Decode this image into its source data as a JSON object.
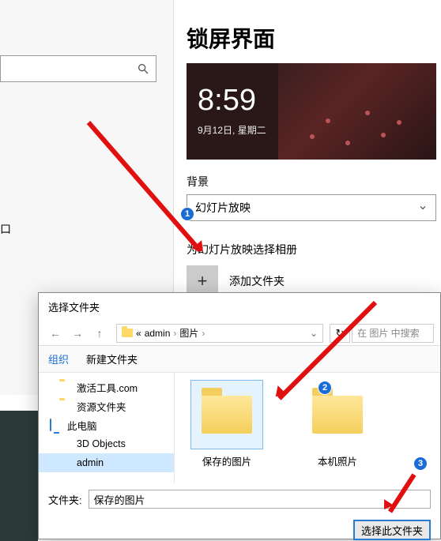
{
  "settings": {
    "title": "锁屏界面",
    "preview": {
      "time": "8:59",
      "date": "9月12日, 星期二"
    },
    "bg_section_label": "背景",
    "bg_dropdown_value": "幻灯片放映",
    "album_label": "为幻灯片放映选择相册",
    "add_folder_label": "添加文件夹"
  },
  "badges": {
    "one": "1",
    "two": "2",
    "three": "3"
  },
  "dialog": {
    "title": "选择文件夹",
    "breadcrumb": {
      "root": "«",
      "p1": "admin",
      "p2": "图片"
    },
    "search_placeholder": "在 图片 中搜索",
    "toolbar": {
      "organize": "组织",
      "new_folder": "新建文件夹"
    },
    "tree": [
      {
        "label": "激活工具.com",
        "icon": "folder"
      },
      {
        "label": "资源文件夹",
        "icon": "folder"
      },
      {
        "label": "此电脑",
        "icon": "pc"
      },
      {
        "label": "3D Objects",
        "icon": "obj"
      },
      {
        "label": "admin",
        "icon": "disk",
        "selected": true
      }
    ],
    "files": [
      {
        "label": "保存的图片",
        "selected": true
      },
      {
        "label": "本机照片",
        "selected": false
      }
    ],
    "folder_field_label": "文件夹:",
    "folder_field_value": "保存的图片",
    "primary_btn": "选择此文件夹"
  }
}
